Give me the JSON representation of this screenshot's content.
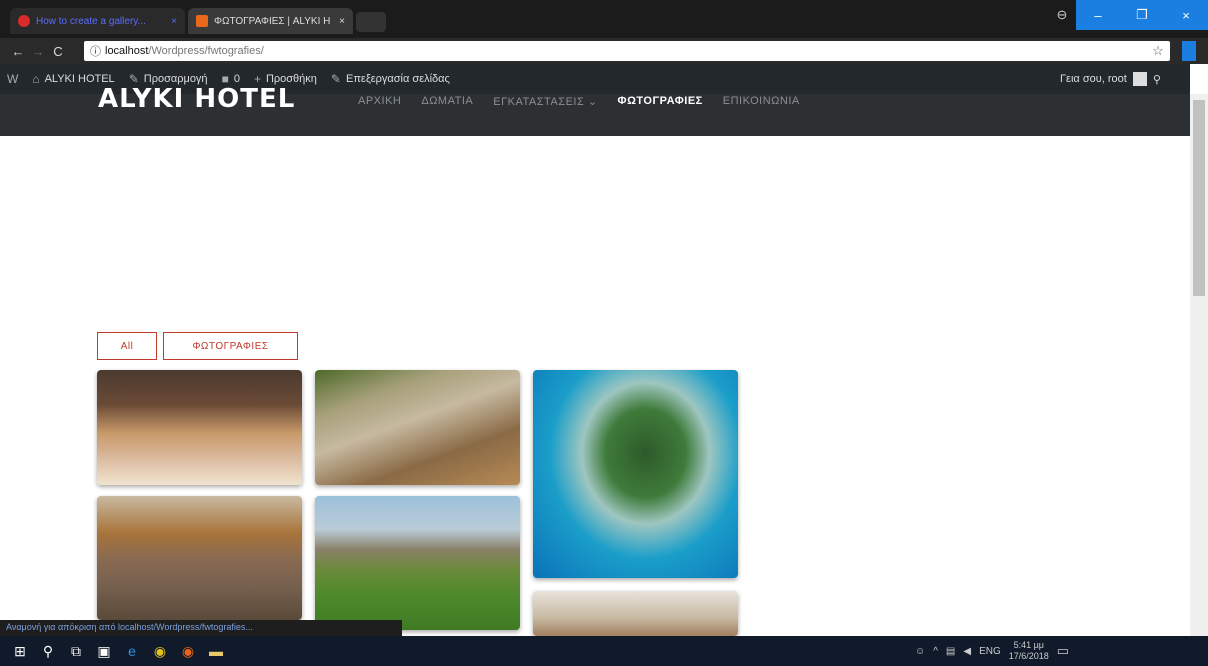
{
  "browser": {
    "tabs": [
      {
        "title": "How to create a gallery...",
        "close": "×"
      },
      {
        "title": "ΦΩΤΟΓΡΑΦΙΕΣ | ALYKI H",
        "close": "×"
      }
    ],
    "window_controls": {
      "profile": "⊖",
      "minimize": "–",
      "maximize": "❐",
      "close": "×"
    },
    "nav": {
      "back": "←",
      "forward": "→",
      "reload": "C"
    },
    "address": {
      "info": "ⓘ",
      "host": "localhost",
      "path": "/Wordpress/fwtografies/"
    },
    "star": "☆"
  },
  "adminbar": {
    "wp_logo": "W",
    "site_name": "ALYKI HOTEL",
    "customize": "Προσαρμογή",
    "comments_count": "0",
    "new": "Προσθήκη",
    "edit_page": "Επεξεργασία σελίδας",
    "greeting": "Γεια σου, root",
    "search_icon": "⚲"
  },
  "site": {
    "logo": "ALYKI HOTEL",
    "nav": [
      "ΑΡΧΙΚΗ",
      "ΔΩΜΑΤΙΑ",
      "ΕΓΚΑΤΑΣΤΑΣΕΙΣ ⌄",
      "ΦΩΤΟΓΡΑΦΙΕΣ",
      "ΕΠΙΚΟΙΝΩΝΙΑ"
    ],
    "active_nav": "ΦΩΤΟΓΡΑΦΙΕΣ"
  },
  "gallery": {
    "filters": [
      "All",
      "ΦΩΤΟΓΡΑΦΙΕΣ"
    ],
    "accent": "#c0392b",
    "images": [
      "restaurant",
      "outdoor-dining",
      "island-aerial",
      "hotel-room",
      "coastal-landscape",
      "room-interior"
    ]
  },
  "status_bar": "Αναμονή για απόκριση από localhost/Wordpress/fwtografies...",
  "taskbar": {
    "start": "⊞",
    "search": "⚲",
    "task_view": "⧉",
    "tray_lang": "ENG",
    "time": "5:41 μμ",
    "date": "17/6/2018"
  }
}
